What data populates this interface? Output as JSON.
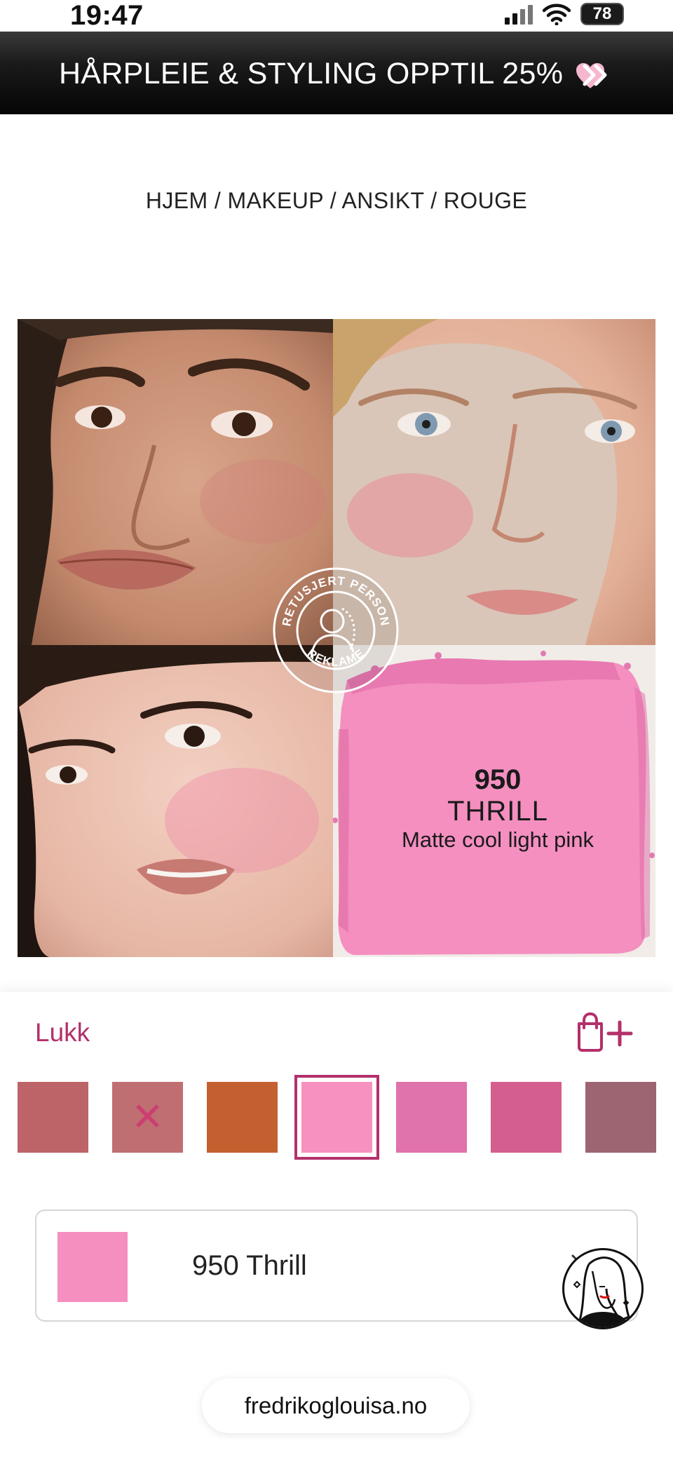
{
  "status_bar": {
    "time": "19:47",
    "battery": "78"
  },
  "promo": {
    "text": "HÅRPLEIE & STYLING OPPTIL 25%",
    "chevrons": "»",
    "icons": [
      "pink-heart-icon",
      "double-chevron-right-icon"
    ]
  },
  "breadcrumb": {
    "text": "HJEM / MAKEUP / ANSIKT / ROUGE"
  },
  "gallery": {
    "badge_lettering": [
      "RETUSJERT PERSON",
      "REKLAME"
    ],
    "product_swatch": {
      "number": "950",
      "name": "THRILL",
      "description": "Matte cool light pink",
      "color": "#f48fc0"
    }
  },
  "panel": {
    "close_label": "Lukk",
    "bag_icon": "shopping-bag-plus-icon",
    "accent_color": "#b3306b",
    "shades": [
      {
        "color": "#bd6469",
        "unavailable": false,
        "selected": false
      },
      {
        "color": "#bf6e72",
        "unavailable": true,
        "selected": false,
        "mark": "✕"
      },
      {
        "color": "#c4602f",
        "unavailable": false,
        "selected": false
      },
      {
        "color": "#f791bf",
        "unavailable": false,
        "selected": true
      },
      {
        "color": "#e072ac",
        "unavailable": false,
        "selected": false
      },
      {
        "color": "#d45e8d",
        "unavailable": false,
        "selected": false
      },
      {
        "color": "#9d6571",
        "unavailable": false,
        "selected": false
      }
    ],
    "selected_shade": {
      "label": "950 Thrill",
      "color": "#f48fc0"
    }
  },
  "footer": {
    "site": "fredrikoglouisa.no"
  }
}
